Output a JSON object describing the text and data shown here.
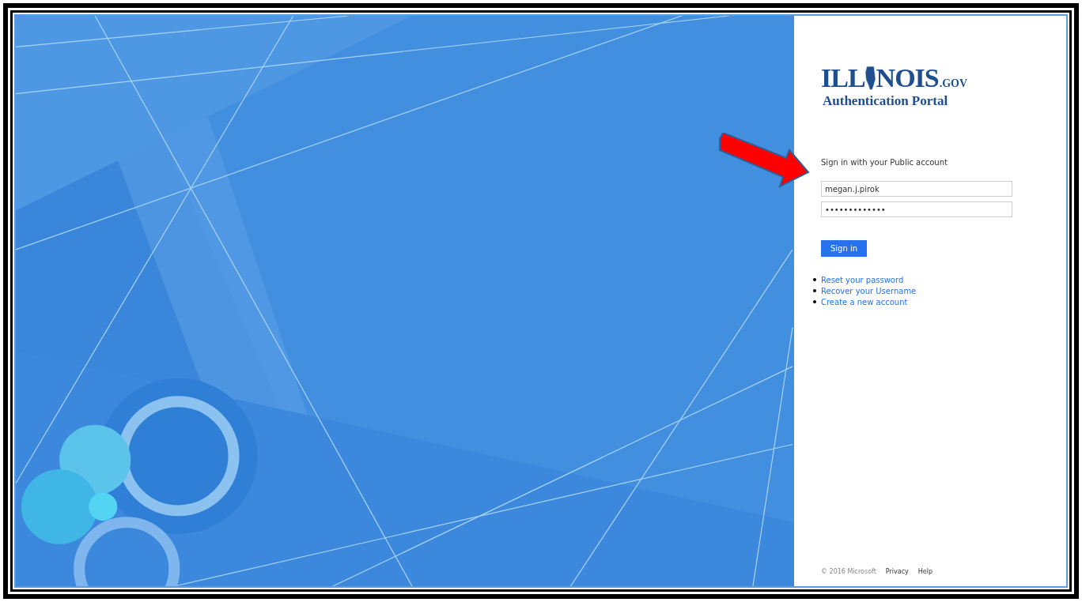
{
  "logo": {
    "left": "ILL",
    "right": "NOIS",
    "suffix": ".GOV",
    "subtitle": "Authentication Portal"
  },
  "prompt": "Sign in with your Public account",
  "username": {
    "value": "megan.j.pirok"
  },
  "password": {
    "value": "•••••••••••••"
  },
  "sign_in_button": "Sign in",
  "links": [
    "Reset your password",
    "Recover your Username",
    "Create a new account"
  ],
  "footer": {
    "copyright": "© 2016 Microsoft",
    "links": [
      "Privacy",
      "Help"
    ]
  },
  "annotation": {
    "kind": "arrow"
  }
}
